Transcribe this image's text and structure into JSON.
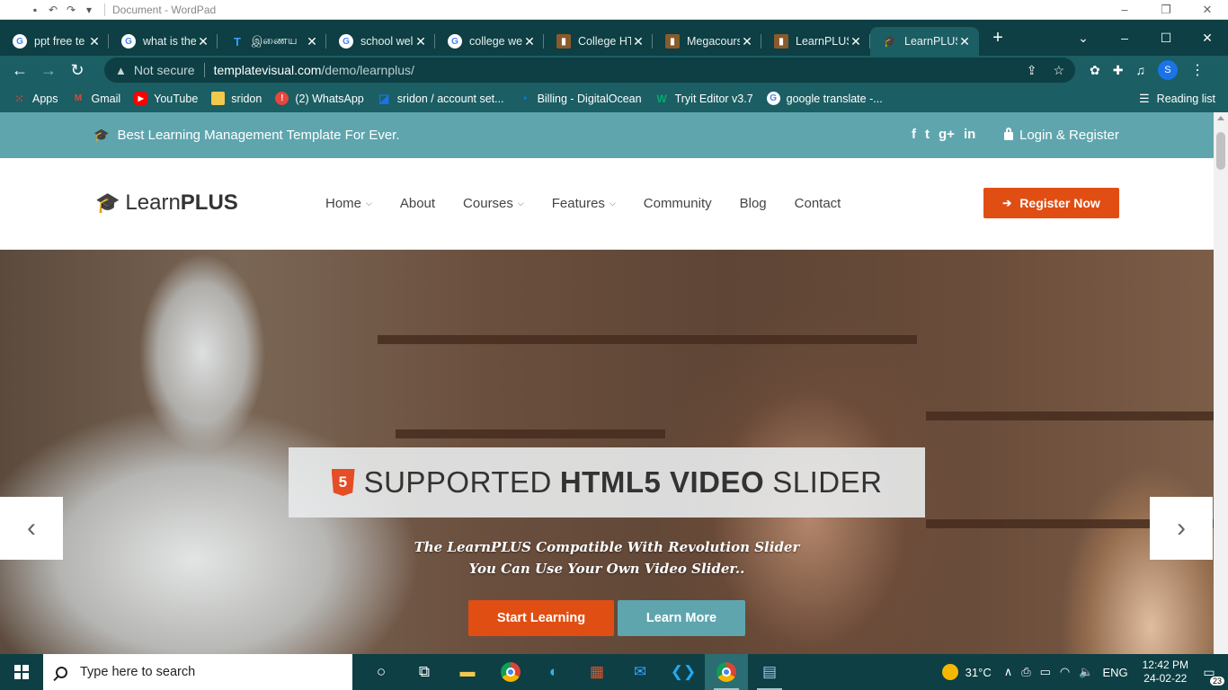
{
  "wordpad": {
    "title": "Document - WordPad"
  },
  "tabs": [
    {
      "label": "ppt free te",
      "fav": "G",
      "type": "g"
    },
    {
      "label": "what is the",
      "fav": "G",
      "type": "g"
    },
    {
      "label": "இணைய",
      "fav": "T",
      "type": "t"
    },
    {
      "label": "school wel",
      "fav": "G",
      "type": "g"
    },
    {
      "label": "college we",
      "fav": "G",
      "type": "g"
    },
    {
      "label": "College HT",
      "fav": "▮",
      "type": "b"
    },
    {
      "label": "Megacours",
      "fav": "▮",
      "type": "b"
    },
    {
      "label": "LearnPLUS",
      "fav": "▮",
      "type": "b"
    },
    {
      "label": "LearnPLUS",
      "fav": "🎓",
      "type": "cap"
    }
  ],
  "address": {
    "security": "Not secure",
    "host": "templatevisual.com",
    "path": "/demo/learnplus/"
  },
  "profile_initial": "S",
  "bookmarks": [
    {
      "label": "Apps",
      "icon": "apps-grid",
      "color": "#ea4335"
    },
    {
      "label": "Gmail",
      "icon": "gmail",
      "color": "#ea4335"
    },
    {
      "label": "YouTube",
      "icon": "youtube",
      "color": "#ff0000"
    },
    {
      "label": "sridon",
      "icon": "folder",
      "color": "#f2c94c"
    },
    {
      "label": "(2) WhatsApp",
      "icon": "whatsapp",
      "color": "#e8453c"
    },
    {
      "label": "sridon / account set...",
      "icon": "account",
      "color": "#1a73e8"
    },
    {
      "label": "Billing - DigitalOcean",
      "icon": "digitalocean",
      "color": "#0080ff"
    },
    {
      "label": "Tryit Editor v3.7",
      "icon": "w3schools",
      "color": "#04aa6d"
    },
    {
      "label": "google translate -...",
      "icon": "google",
      "color": "#ffffff"
    }
  ],
  "reading_list": "Reading list",
  "site": {
    "topbar": {
      "tagline": "Best Learning Management Template For Ever.",
      "social": [
        "f",
        "t",
        "g+",
        "in"
      ],
      "login": "Login & Register"
    },
    "logo": {
      "light": "Learn",
      "bold": "PLUS"
    },
    "menu": [
      {
        "label": "Home",
        "dropdown": true
      },
      {
        "label": "About",
        "dropdown": false
      },
      {
        "label": "Courses",
        "dropdown": true
      },
      {
        "label": "Features",
        "dropdown": true
      },
      {
        "label": "Community",
        "dropdown": false
      },
      {
        "label": "Blog",
        "dropdown": false
      },
      {
        "label": "Contact",
        "dropdown": false
      }
    ],
    "register_button": "Register Now",
    "hero": {
      "badge": "5",
      "caption_pre": "SUPPORTED",
      "caption_bold": "HTML5 VIDEO",
      "caption_post": "SLIDER",
      "line1": "The LearnPLUS Compatible With Revolution Slider",
      "line2": "You Can Use Your Own Video Slider..",
      "start_button": "Start Learning",
      "more_button": "Learn More"
    }
  },
  "taskbar": {
    "search_placeholder": "Type here to search",
    "weather": "31°C",
    "lang": "ENG",
    "time": "12:42 PM",
    "date": "24-02-22",
    "notifications": "23"
  },
  "colors": {
    "chrome_dark": "#0d3f44",
    "chrome_mid": "#1b5e64",
    "teal": "#5fa5ae",
    "orange": "#e04e14"
  }
}
